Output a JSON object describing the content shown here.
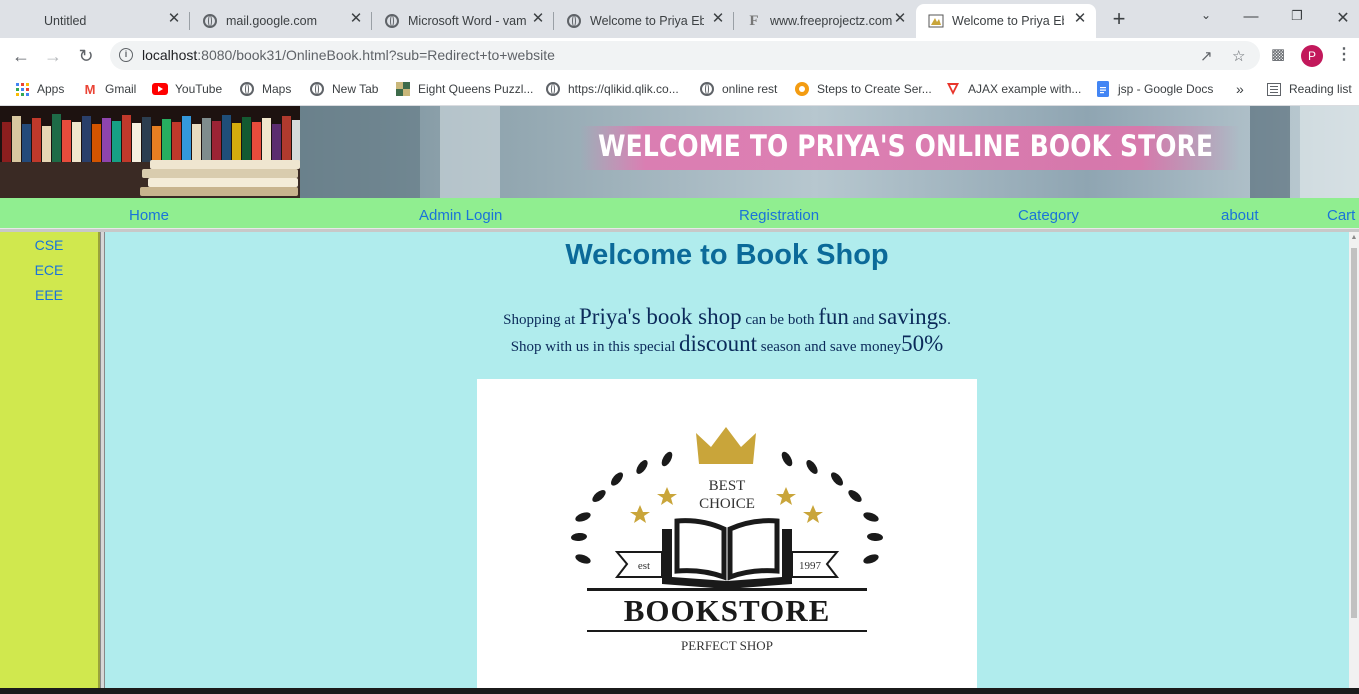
{
  "browser": {
    "tabs": [
      {
        "title": "Untitled",
        "icon": "none"
      },
      {
        "title": "mail.google.com",
        "icon": "globe-icon"
      },
      {
        "title": "Microsoft Word - vam",
        "icon": "globe-icon"
      },
      {
        "title": "Welcome to Priya Ebo",
        "icon": "globe-icon"
      },
      {
        "title": "www.freeprojectz.com",
        "icon": "freeprojectz-icon"
      },
      {
        "title": "Welcome to Priya Ebo",
        "icon": "book-favicon",
        "active": true
      }
    ],
    "tab_close_glyph": "✕",
    "new_tab_glyph": "+",
    "url_host": "localhost",
    "url_path": ":8080/book31/OnlineBook.html?sub=Redirect+to+website",
    "profile_initial": "P",
    "bookmarks": [
      {
        "label": "Apps",
        "icon": "apps-grid-icon"
      },
      {
        "label": "Gmail",
        "icon": "gmail-icon"
      },
      {
        "label": "YouTube",
        "icon": "youtube-icon"
      },
      {
        "label": "Maps",
        "icon": "globe-icon"
      },
      {
        "label": "New Tab",
        "icon": "globe-icon"
      },
      {
        "label": "Eight Queens Puzzl...",
        "icon": "chess-icon"
      },
      {
        "label": "https://qlikid.qlik.co...",
        "icon": "globe-icon"
      },
      {
        "label": "online rest",
        "icon": "globe-icon"
      },
      {
        "label": "Steps to Create Ser...",
        "icon": "tutorial-icon"
      },
      {
        "label": "AJAX example with...",
        "icon": "vtriangle-icon"
      },
      {
        "label": "jsp - Google Docs",
        "icon": "docs-icon"
      }
    ],
    "bookmarks_overflow": "»",
    "reading_list": "Reading list"
  },
  "site": {
    "banner_title": "WELCOME TO PRIYA'S ONLINE BOOK STORE",
    "menu": [
      "Home",
      "Admin Login",
      "Registration",
      "Category",
      "about",
      "Cart"
    ],
    "sidebar": [
      "CSE",
      "ECE",
      "EEE"
    ],
    "heading": "Welcome to Book Shop",
    "intro_line1": {
      "a": "Shopping at ",
      "b": "Priya's book shop",
      "c": " can be both ",
      "d": "fun",
      "e": " and ",
      "f": "savings",
      "g": "."
    },
    "intro_line2": {
      "a": "Shop with us in this special ",
      "b": "discount",
      "c": " season and save money",
      "d": "50%"
    },
    "logo": {
      "top": "BEST",
      "middle": "CHOICE",
      "est": "est",
      "year": "1997",
      "name": "BOOKSTORE",
      "tagline": "PERFECT SHOP",
      "gold": "#c9a53a"
    }
  },
  "colors": {
    "page_bg": "#b0eced",
    "menubar": "#90ee90",
    "sidebar": "#d0e84e",
    "link": "#1a73d9",
    "heading": "#0b6a99"
  }
}
